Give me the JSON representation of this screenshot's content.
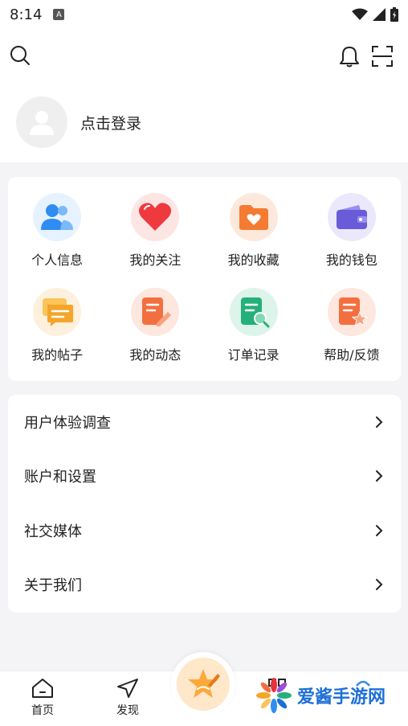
{
  "status_bar": {
    "time": "8:14",
    "a_badge": "A"
  },
  "header": {
    "login_text": "点击登录"
  },
  "grid": {
    "items": [
      {
        "label": "个人信息",
        "icon": "person-icon",
        "color": "#2f8cf1",
        "bg": "#e6f2ff"
      },
      {
        "label": "我的关注",
        "icon": "heart-icon",
        "color": "#ee3a3f",
        "bg": "#fde5e4"
      },
      {
        "label": "我的收藏",
        "icon": "folder-heart-icon",
        "color": "#f37b32",
        "bg": "#fde9dc"
      },
      {
        "label": "我的钱包",
        "icon": "wallet-icon",
        "color": "#6a5bd8",
        "bg": "#ebe8fb"
      },
      {
        "label": "我的帖子",
        "icon": "chat-icon",
        "color": "#f4a52a",
        "bg": "#fdf0dc"
      },
      {
        "label": "我的动态",
        "icon": "edit-doc-icon",
        "color": "#f36f3f",
        "bg": "#fde7de"
      },
      {
        "label": "订单记录",
        "icon": "search-doc-icon",
        "color": "#25b07a",
        "bg": "#ddf4ea"
      },
      {
        "label": "帮助/反馈",
        "icon": "star-doc-icon",
        "color": "#f36f3f",
        "bg": "#fde7de"
      }
    ]
  },
  "menu": {
    "items": [
      {
        "label": "用户体验调查"
      },
      {
        "label": "账户和设置"
      },
      {
        "label": "社交媒体"
      },
      {
        "label": "关于我们"
      }
    ]
  },
  "bottom_nav": {
    "home_label": "首页",
    "discover_label": "发现"
  },
  "watermark": {
    "text": "爱酱手游网"
  }
}
